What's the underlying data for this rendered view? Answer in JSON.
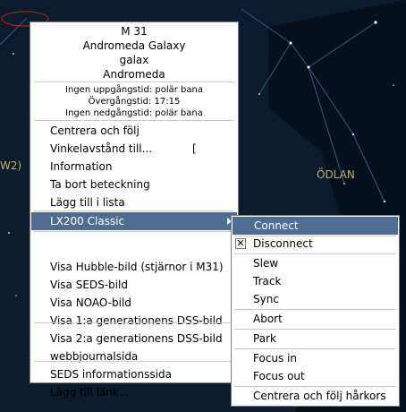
{
  "colors": {
    "sky_bg": "#0b1a2d",
    "highlight": "#4f6d93",
    "constellation_label": "#c4b06a",
    "circle": "#b31c1c"
  },
  "sky": {
    "left_label": "W2)",
    "constellation_label": "ÖDLAN"
  },
  "popup": {
    "header": {
      "name": "M 31",
      "long_name": "Andromeda Galaxy",
      "type": "galax",
      "constellation": "Andromeda",
      "rise": "Ingen uppgångstid: polär bana",
      "transit": "Övergångstid: 17:15",
      "set": "Ingen nedgångstid: polär bana"
    },
    "items": {
      "center_track": "Centrera och följ",
      "angular_distance": "Vinkelavstånd till...",
      "angular_distance_shortcut": "[",
      "information": "Information",
      "remove_label": "Ta bort beteckning",
      "add_to_list": "Lägg till i lista",
      "telescope": "LX200 Classic",
      "hubble": "Visa Hubble-bild (stjärnor i M31)",
      "seds_image": "Visa SEDS-bild",
      "noao": "Visa NOAO-bild",
      "dss1": "Visa 1:a generationens DSS-bild",
      "dss2": "Visa 2:a generationens DSS-bild",
      "weblog": "webbjournalsida",
      "seds_info": "SEDS informationssida",
      "add_link": "Lägg till länk..."
    }
  },
  "submenu": {
    "connect": "Connect",
    "disconnect": "Disconnect",
    "disconnect_checked": true,
    "slew": "Slew",
    "track": "Track",
    "sync": "Sync",
    "abort": "Abort",
    "park": "Park",
    "focus_in": "Focus in",
    "focus_out": "Focus out",
    "center_crosshair": "Centrera och följ hårkors"
  }
}
